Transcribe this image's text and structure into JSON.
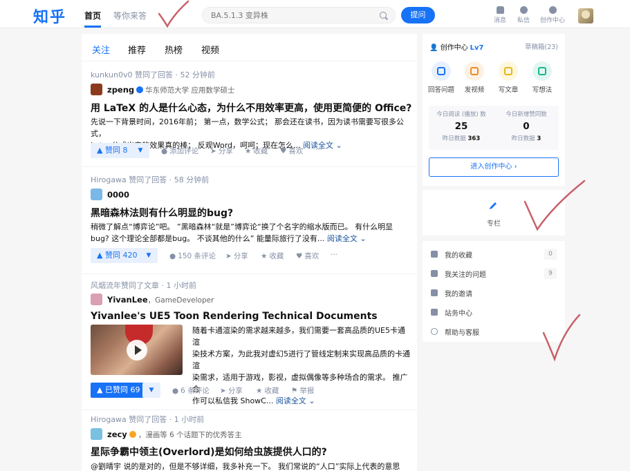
{
  "topbar": {
    "logo": "知乎",
    "tabs": [
      "首页",
      "等你来答"
    ],
    "search_placeholder": "BA.5.1.3 变异株",
    "ask_label": "提问",
    "icons": [
      {
        "name": "bell-icon",
        "label": "消息"
      },
      {
        "name": "chat-icon",
        "label": "私信"
      },
      {
        "name": "creator-icon",
        "label": "创作中心"
      }
    ]
  },
  "feed": {
    "tabs": [
      "关注",
      "推荐",
      "热榜",
      "视频"
    ],
    "cards": [
      {
        "meta": "kunkun0v0 赞同了回答 · 52 分钟前",
        "author": "zpeng",
        "author_desc": "华东师范大学 应用数学硕士",
        "title": "用 LaTeX 的人是什么心态，为什么不用效率更高，使用更简便的 Office?",
        "excerpt_line1": "先说一下背景时间，2016年前； 第一点，数学公式； 那会还在读书，因为读书需要写很多公式，",
        "excerpt_line2": "Latex公式出来的效果真的棒； 反观Word，呵呵；现在怎么...",
        "read_more": "阅读全文 ⌄",
        "vote": "▲ 赞同 8",
        "actions": [
          "添加评论",
          "分享",
          "收藏",
          "喜欢",
          "···"
        ]
      },
      {
        "meta": "Hirogawa 赞同了回答 · 58 分钟前",
        "author": "0000",
        "author_desc": "",
        "title": "黑暗森林法则有什么明显的bug?",
        "excerpt_line1": "稍微了解点“博弈论”吧。 ”黑暗森林“就是”博弈论“换了个名字的缩水版而已。 有什么明显",
        "excerpt_line2": "bug? 这个理论全部都是bug。 不谈其他的什么” 能量际旅行了没有...",
        "read_more": "阅读全文 ⌄",
        "vote": "▲ 赞同 420",
        "actions": [
          "150 条评论",
          "分享",
          "收藏",
          "喜欢",
          "···"
        ]
      },
      {
        "meta": "风烟流年赞同了文章 · 1 小时前",
        "author": "YivanLee",
        "author_desc": "GameDeveloper",
        "title": "Yivanlee's UE5 Toon Rendering Technical Documents",
        "excerpt_lines": [
          "随着卡通渲染的需求越来越多，我们需要一套高品质的UE5卡通渲",
          "染技术方案，为此我对虚幻5进行了管线定制来实现高品质的卡通渲",
          "染需求，适用于游戏，影视，虚拟偶像等多种场合的需求。 推广合",
          "作可以私信我 ShowC..."
        ],
        "read_more": "阅读全文 ⌄",
        "vote": "▲ 已赞同 69",
        "actions": [
          "6 条评论",
          "分享",
          "收藏",
          "举报"
        ]
      },
      {
        "meta": "Hirogawa 赞同了回答 · 1 小时前",
        "author": "zecy",
        "author_desc": "漫画等 6 个话题下的优秀答主",
        "title": "星际争霸中领主(Overlord)是如何给虫族提供人口的?",
        "excerpt_line1": "@劉晴宇 说的是对的，但是不够详细，我多补充一下。 我们常说的“人口”实际上代表的意思是"
      }
    ]
  },
  "creator": {
    "title": "创作中心",
    "level": "Lv7",
    "drafts": "草稿箱(23)",
    "quick": [
      "回答问题",
      "发视频",
      "写文章",
      "写想法"
    ],
    "today_reads_label": "今日阅读 (播放) 数",
    "today_reads": "25",
    "yesterday_reads": "363",
    "today_likes_label": "今日新增赞同数",
    "today_likes": "0",
    "yesterday_likes": "3",
    "yesterday_label": "昨日数据",
    "enter_label": "进入创作中心 ›"
  },
  "zhuanlan": {
    "label": "专栏"
  },
  "links": [
    {
      "label": "我的收藏",
      "count": "0"
    },
    {
      "label": "我关注的问题",
      "count": "9"
    },
    {
      "label": "我的邀请",
      "count": ""
    },
    {
      "label": "站务中心",
      "count": ""
    },
    {
      "label": "帮助与客服",
      "count": ""
    }
  ],
  "colors": {
    "brand": "#1772f6",
    "annotation_checkmarks": "#c8606a"
  }
}
